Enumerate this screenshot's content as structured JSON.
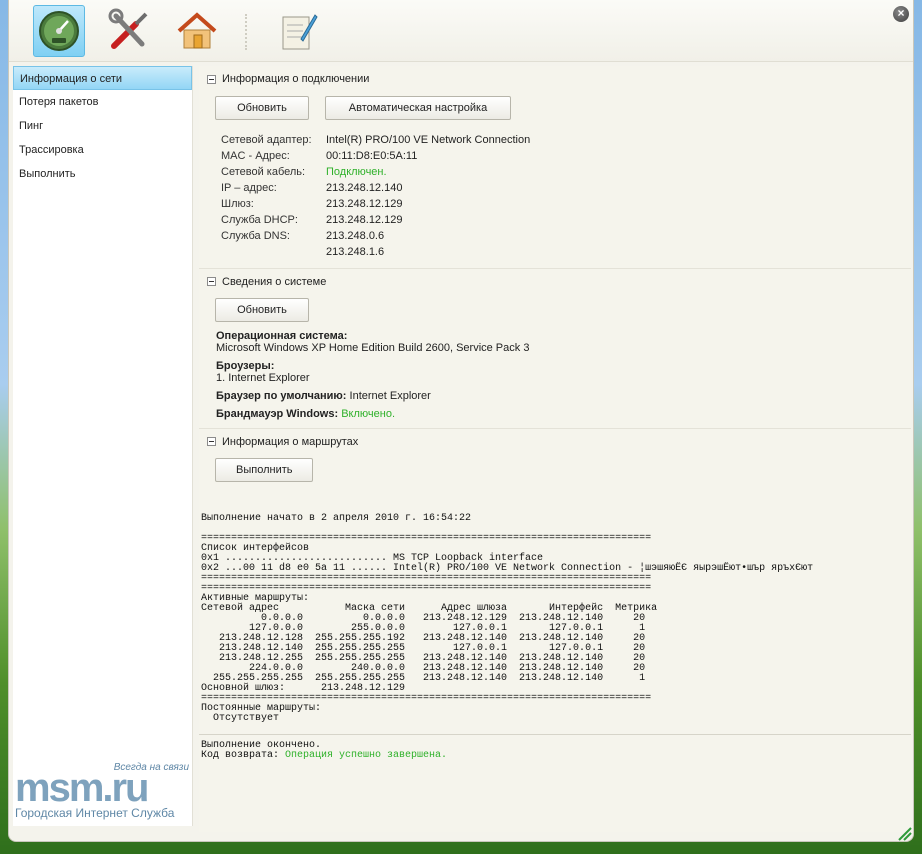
{
  "toolbar": {
    "items": [
      {
        "icon": "speedometer-icon",
        "active": true
      },
      {
        "icon": "tools-icon",
        "active": false
      },
      {
        "icon": "home-icon",
        "active": false
      },
      {
        "icon": "notepad-icon",
        "active": false
      }
    ],
    "close_label": "×"
  },
  "sidebar": {
    "items": [
      {
        "label": "Информация о сети",
        "selected": true
      },
      {
        "label": "Потеря пакетов",
        "selected": false
      },
      {
        "label": "Пинг",
        "selected": false
      },
      {
        "label": "Трассировка",
        "selected": false
      },
      {
        "label": "Выполнить",
        "selected": false
      }
    ],
    "logo": {
      "tagline": "Всегда на связи",
      "brand": "msm.ru",
      "subtitle": "Городская Интернет Служба"
    }
  },
  "connection": {
    "title": "Информация о подключении",
    "refresh_label": "Обновить",
    "auto_config_label": "Автоматическая настройка",
    "rows": [
      {
        "key": "Сетевой адаптер:",
        "value": "Intel(R) PRO/100 VE Network Connection"
      },
      {
        "key": "MAC - Адрес:",
        "value": "00:11:D8:E0:5A:11"
      },
      {
        "key": "Сетевой кабель:",
        "value": "Подключен.",
        "status": "ok"
      },
      {
        "key": "IP – адрес:",
        "value": "213.248.12.140"
      },
      {
        "key": "Шлюз:",
        "value": "213.248.12.129"
      },
      {
        "key": "Служба DHCP:",
        "value": "213.248.12.129"
      },
      {
        "key": "Служба DNS:",
        "value": "213.248.0.6"
      },
      {
        "key": "",
        "value": "213.248.1.6"
      }
    ]
  },
  "system": {
    "title": "Сведения о системе",
    "refresh_label": "Обновить",
    "os_label": "Операционная система:",
    "os_value": "Microsoft Windows XP Home Edition Build 2600, Service Pack 3",
    "browsers_label": "Броузеры:",
    "browsers_value": "1. Internet Explorer",
    "default_browser_label": "Браузер по умолчанию:",
    "default_browser_value": "Internet Explorer",
    "firewall_label": "Брандмауэр Windows:",
    "firewall_value": "Включено.",
    "status_color": "#2fb12a"
  },
  "routes": {
    "title": "Информация о маршрутах",
    "run_label": "Выполнить",
    "started": "Выполнение начато в 2 апреля 2010 г. 16:54:22",
    "output": "===========================================================================\nСписок интерфейсов\n0x1 ........................... MS TCP Loopback interface\n0x2 ...00 11 d8 e0 5a 11 ...... Intel(R) PRO/100 VE Network Connection - ¦шэшяюЁЄ яырэшЁют•шър яръхЄют\n===========================================================================\n===========================================================================\nАктивные маршруты:\nСетевой адрес           Маска сети      Адрес шлюза       Интерфейс  Метрика\n          0.0.0.0          0.0.0.0   213.248.12.129  213.248.12.140     20\n        127.0.0.0        255.0.0.0        127.0.0.1       127.0.0.1      1\n   213.248.12.128  255.255.255.192   213.248.12.140  213.248.12.140     20\n   213.248.12.140  255.255.255.255        127.0.0.1       127.0.0.1     20\n   213.248.12.255  255.255.255.255   213.248.12.140  213.248.12.140     20\n        224.0.0.0        240.0.0.0   213.248.12.140  213.248.12.140     20\n  255.255.255.255  255.255.255.255   213.248.12.140  213.248.12.140      1\nОсновной шлюз:      213.248.12.129\n===========================================================================\nПостоянные маршруты:\n  Отсутствует",
    "finished": "Выполнение окончено.",
    "return_code_label": "Код возврата:",
    "return_code_value": "Операция успешно завершена."
  }
}
